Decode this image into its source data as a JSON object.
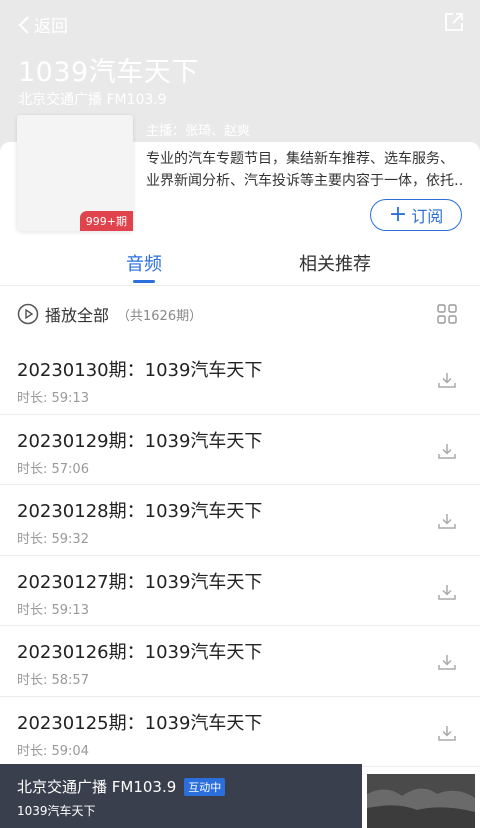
{
  "nav": {
    "back_label": "返回"
  },
  "program": {
    "title": "1039汽车天下",
    "station": "北京交通广播 FM103.9",
    "hosts": "主播：张琦、赵爽",
    "desc_line1": "专业的汽车专题节目，集结新车推荐、选车服务、",
    "desc_line2": "业界新闻分析、汽车投诉等主要内容于一体，依托…",
    "episode_badge": "999+期",
    "subscribe_label": "订阅"
  },
  "tabs": [
    {
      "label": "音频",
      "active": true
    },
    {
      "label": "相关推荐",
      "active": false
    }
  ],
  "playall": {
    "label": "播放全部",
    "count": "（共1626期）"
  },
  "episodes": [
    {
      "title": "20230130期：1039汽车天下",
      "duration": "时长: 59:13"
    },
    {
      "title": "20230129期：1039汽车天下",
      "duration": "时长: 57:06"
    },
    {
      "title": "20230128期：1039汽车天下",
      "duration": "时长: 59:32"
    },
    {
      "title": "20230127期：1039汽车天下",
      "duration": "时长: 59:13"
    },
    {
      "title": "20230126期：1039汽车天下",
      "duration": "时长: 58:57"
    },
    {
      "title": "20230125期：1039汽车天下",
      "duration": "时长: 59:04"
    }
  ],
  "player": {
    "station": "北京交通广播 FM103.9",
    "badge": "互动中",
    "program": "1039汽车天下"
  },
  "colors": {
    "accent": "#2a6fdb",
    "badge_red": "#e0434b",
    "player_bg": "#3a3f4d"
  },
  "icons": [
    "back-chevron-icon",
    "share-icon",
    "plus-icon",
    "play-circle-icon",
    "grid-icon",
    "download-icon"
  ]
}
